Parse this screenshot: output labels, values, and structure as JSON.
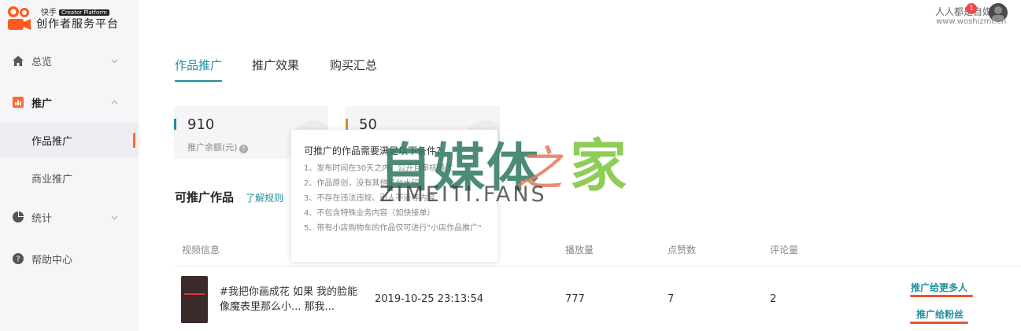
{
  "logo": {
    "brand": "快手",
    "badge": "Creator Platform",
    "title": "创作者服务平台"
  },
  "user": {
    "name": "人人都是自媒体",
    "badge_count": "1",
    "watermark_url": "www.woshizmt.cn"
  },
  "sidebar": {
    "overview": "总览",
    "promote": "推广",
    "works_promote": "作品推广",
    "business_promote": "商业推广",
    "stats": "统计",
    "help": "帮助中心"
  },
  "tabs": [
    "作品推广",
    "推广效果",
    "购买汇总"
  ],
  "cards": [
    {
      "value": "910",
      "label": "推广余额(元)",
      "accent": "#1f8f9d"
    },
    {
      "value": "50",
      "label": "",
      "accent": "#e2842b"
    }
  ],
  "section": {
    "title": "可推广作品",
    "rules_link": "了解规则"
  },
  "popover": {
    "title": "可推广的作品需要满足以下条件?",
    "items": [
      "1、发布时间在30天之内，公开且审核通过",
      "2、作品原创，没有其他平台水印",
      "3、不存在违法违规、引人不适等内容",
      "4、不包含特殊业务内容（如快接单）",
      "5、带有小店购物车的作品仅可进行\"小店作品推广\""
    ]
  },
  "table": {
    "headers": [
      "视频信息",
      "播放量",
      "点赞数",
      "评论量"
    ],
    "rows": [
      {
        "title": "#我把你画成花 如果 我的脸能像魔表里那么小... 那我...",
        "time": "2019-10-25 23:13:54",
        "plays": "777",
        "likes": "7",
        "comments": "2",
        "action_more": "推广给更多人",
        "action_fans": "推广给粉丝"
      }
    ]
  },
  "watermark": {
    "cn": "自媒体",
    "zhi": "之",
    "jia": "家",
    "en": "ZIMEITI.FANS"
  },
  "colors": {
    "accent": "#1f8f9d",
    "active_bar": "#ff6a2a",
    "underline": "#e2582b"
  }
}
